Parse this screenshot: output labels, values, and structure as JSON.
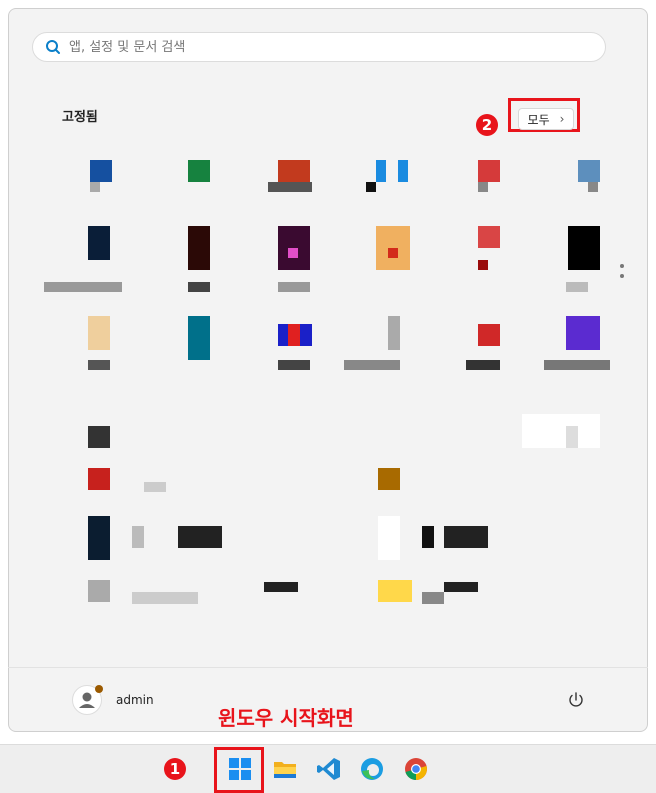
{
  "search": {
    "placeholder": "앱, 설정 및 문서 검색"
  },
  "pinned": {
    "title": "고정됨",
    "all_button_label": "모두",
    "all_button_chevron": "›"
  },
  "annotations": {
    "badge_1": "1",
    "badge_2": "2",
    "caption": "윈도우 시작화면"
  },
  "user": {
    "name": "admin"
  },
  "taskbar": {
    "items": [
      "start-icon",
      "file-explorer-icon",
      "vscode-icon",
      "edge-icon",
      "chrome-icon"
    ]
  },
  "colors": {
    "annotation_red": "#e8141b",
    "panel_bg": "#f3f3f3"
  }
}
